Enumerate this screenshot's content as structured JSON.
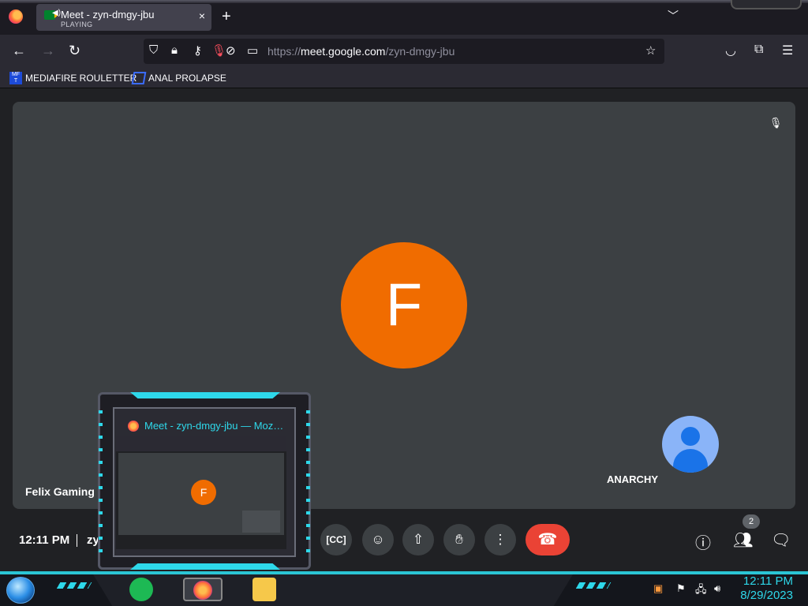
{
  "browser": {
    "tab": {
      "title": "Meet - zyn-dmgy-jbu",
      "status": "PLAYING",
      "close": "×"
    },
    "new_tab": "+",
    "tab_list": "⌄",
    "nav": {
      "back": "←",
      "forward": "→",
      "reload": "↻"
    },
    "url": {
      "prefix": "https://",
      "host": "meet.google.com",
      "path": "/zyn-dmgy-jbu"
    },
    "bookmarks": [
      {
        "label": "MEDIAFIRE ROULETTER",
        "icon_text": "MF T"
      },
      {
        "label": "ANAL PROLAPSE"
      }
    ]
  },
  "meet": {
    "main_participant": {
      "initial": "F",
      "name": "Felix Gaming E",
      "avatar_color": "#f06c00"
    },
    "self_tile": {
      "name": "ANARCHY"
    },
    "clock": "12:11 PM",
    "meeting_code_truncated": "zy",
    "participant_count": "2",
    "controls": [
      "captions",
      "emoji",
      "present",
      "raise-hand",
      "more",
      "end-call"
    ]
  },
  "thumbnail": {
    "title": "Meet - zyn-dmgy-jbu — Moz…",
    "initial": "F"
  },
  "taskbar": {
    "time": "12:11 PM",
    "date": "8/29/2023",
    "accent": "#2ed8ea"
  }
}
